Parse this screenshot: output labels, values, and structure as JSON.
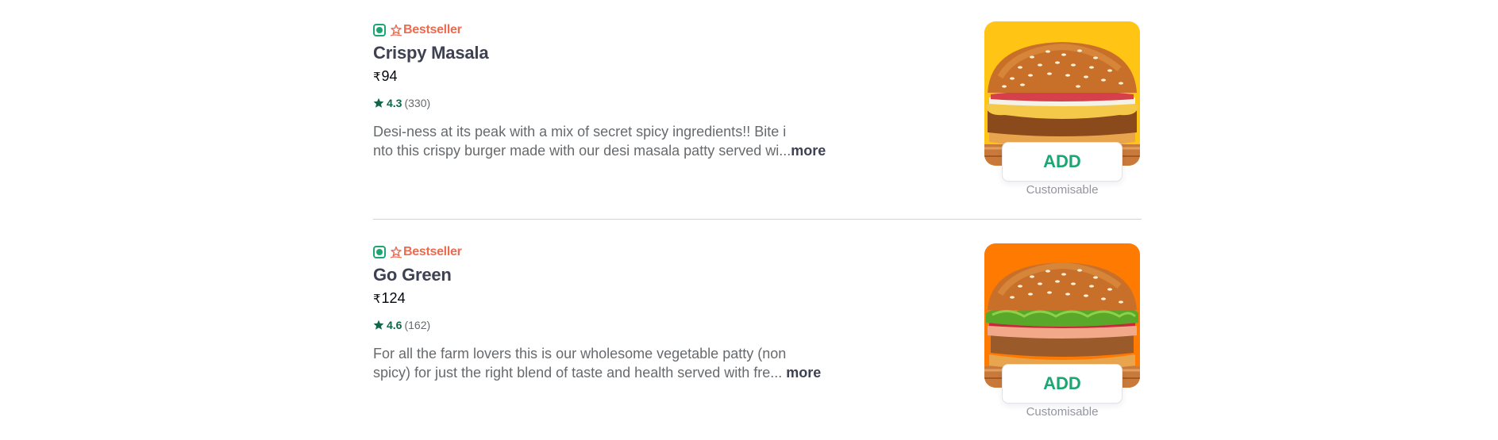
{
  "items": [
    {
      "badge": "Bestseller",
      "name": "Crispy Masala",
      "currency": "₹",
      "price": "94",
      "rating": "4.3",
      "rating_count": "(330)",
      "description_line1": "Desi-ness at its peak with a mix of secret spicy ingredients!! Bite i",
      "description_line2": "nto this crispy burger made with our desi masala patty served wi...",
      "more": "more",
      "add_label": "ADD",
      "customisable": "Customisable",
      "bg_color": "#ffc414"
    },
    {
      "badge": "Bestseller",
      "name": "Go Green",
      "currency": "₹",
      "price": "124",
      "rating": "4.6",
      "rating_count": "(162)",
      "description_line1": "For all the farm lovers this is our wholesome vegetable patty (non",
      "description_line2": "spicy) for just the right blend of taste and health served with fre...",
      "more": "more",
      "add_label": "ADD",
      "customisable": "Customisable",
      "bg_color": "#ff7a00"
    }
  ],
  "colors": {
    "veg": "#1ba672",
    "bestseller": "#ee6a4f",
    "rating": "#116649",
    "add": "#1ba672"
  }
}
